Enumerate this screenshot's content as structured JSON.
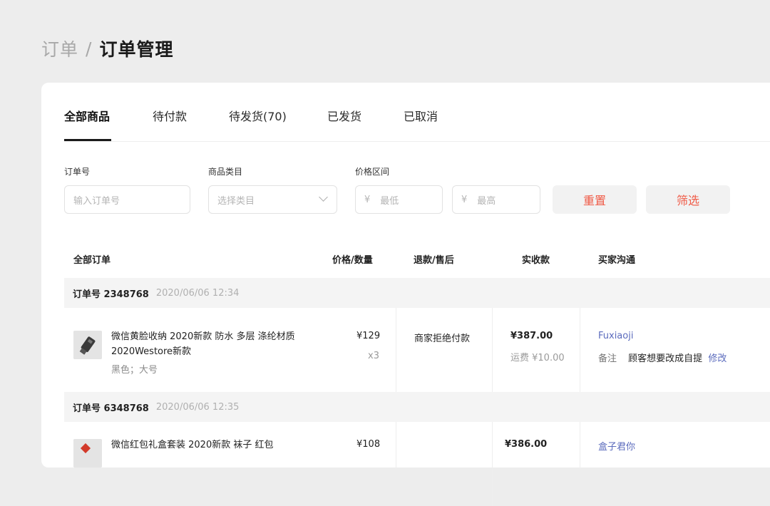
{
  "breadcrumb": {
    "parent": "订单",
    "separator": "/",
    "current": "订单管理"
  },
  "tabs": [
    {
      "label": "全部商品",
      "active": true
    },
    {
      "label": "待付款"
    },
    {
      "label": "待发货(70)"
    },
    {
      "label": "已发货"
    },
    {
      "label": "已取消"
    }
  ],
  "filters": {
    "order_no": {
      "label": "订单号",
      "placeholder": "输入订单号"
    },
    "category": {
      "label": "商品类目",
      "placeholder": "选择类目"
    },
    "price": {
      "label": "价格区间",
      "currency": "¥",
      "min_placeholder": "最低",
      "max_placeholder": "最高"
    },
    "reset_label": "重置",
    "filter_label": "筛选"
  },
  "table": {
    "headers": [
      "全部订单",
      "价格/数量",
      "退款/售后",
      "实收款",
      "买家沟通"
    ]
  },
  "orders": [
    {
      "id": "订单号 2348768",
      "date": "2020/06/06 12:34",
      "product_name": "微信黄脸收纳 2020新款 防水 多层 涤纶材质 2020Westore新款",
      "spec": "黑色；大号",
      "price": "¥129",
      "qty": "x3",
      "refund": "商家拒绝付款",
      "total": "¥387.00",
      "shipping": "运费 ¥10.00",
      "buyer": "Fuxiaoji",
      "note_label": "备注",
      "note": "顾客想要改成自提",
      "edit_label": "修改"
    },
    {
      "id": "订单号 6348768",
      "date": "2020/06/06 12:35",
      "product_name": "微信红包礼盒套装 2020新款 袜子 红包",
      "price": "¥108",
      "total": "¥386.00",
      "buyer": "盒子君你"
    }
  ],
  "colors": {
    "accent": "#f05a46",
    "link": "#5b6bbd"
  }
}
